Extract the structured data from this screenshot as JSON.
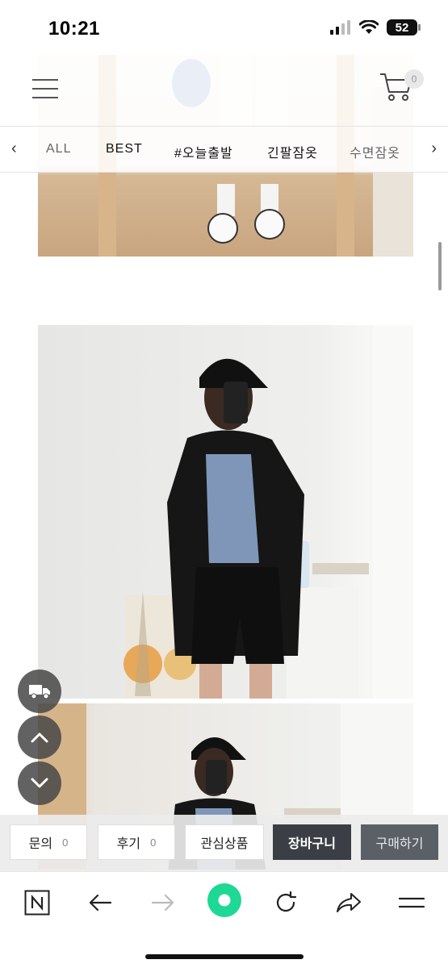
{
  "status_bar": {
    "time": "10:21",
    "battery": "52"
  },
  "header": {
    "cart_count": "0"
  },
  "category_nav": {
    "items": [
      "ALL",
      "BEST",
      "#오늘출발",
      "긴팔잠옷",
      "수면잠옷"
    ]
  },
  "action_bar": {
    "inquiry_label": "문의",
    "inquiry_count": "0",
    "review_label": "후기",
    "review_count": "0",
    "wishlist_label": "관심상품",
    "cart_label": "장바구니",
    "buy_label": "구매하기"
  },
  "icons": {
    "menu": "hamburger-icon",
    "cart": "shopping-cart-icon",
    "prev": "chevron-left-icon",
    "next": "chevron-right-icon",
    "delivery": "truck-icon",
    "scroll_up": "chevron-up-icon",
    "scroll_down": "chevron-down-icon",
    "browser_home": "naver-n-icon",
    "back": "arrow-left-icon",
    "forward": "arrow-right-icon",
    "green_dot": "green-circle-icon",
    "reload": "reload-icon",
    "share": "share-icon",
    "more_menu": "hamburger-icon"
  },
  "colors": {
    "accent_green": "#1ed896",
    "dark_button": "#3b3f45"
  }
}
